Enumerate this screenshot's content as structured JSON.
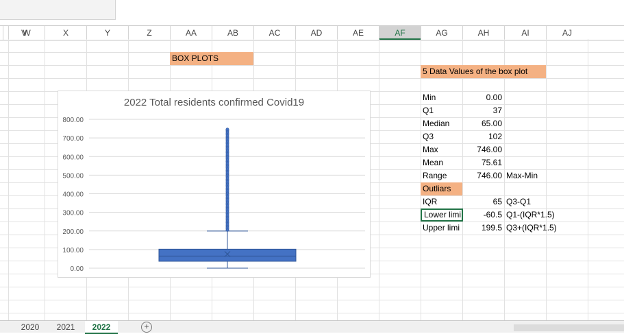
{
  "columns": [
    "V",
    "W",
    "X",
    "Y",
    "Z",
    "AA",
    "AB",
    "AC",
    "AD",
    "AE",
    "AF",
    "AG",
    "AH",
    "AI",
    "AJ"
  ],
  "active_column": "AF",
  "sheet": {
    "box_plots_label": "BOX PLOTS",
    "five_values_label": "5 Data Values of the box plot",
    "outliers_label": "Outliars",
    "stats": [
      {
        "label": "Min",
        "value": "0.00",
        "note": ""
      },
      {
        "label": "Q1",
        "value": "37",
        "note": ""
      },
      {
        "label": "Median",
        "value": "65.00",
        "note": ""
      },
      {
        "label": "Q3",
        "value": "102",
        "note": ""
      },
      {
        "label": "Max",
        "value": "746.00",
        "note": ""
      },
      {
        "label": "Mean",
        "value": "75.61",
        "note": ""
      },
      {
        "label": "Range",
        "value": "746.00",
        "note": "Max-Min"
      }
    ],
    "outlier_stats": [
      {
        "label": "IQR",
        "value": "65",
        "note": "Q3-Q1"
      },
      {
        "label": "Lower limi",
        "value": "-60.5",
        "note": "Q1-(IQR*1.5)"
      },
      {
        "label": "Upper limi",
        "value": "199.5",
        "note": "Q3+(IQR*1.5)"
      }
    ]
  },
  "chart_data": {
    "type": "box",
    "title": "2022 Total residents confirmed Covid19",
    "xlabel": "",
    "ylabel": "",
    "ylim": [
      0,
      800
    ],
    "yticks": [
      "800.00",
      "700.00",
      "600.00",
      "500.00",
      "400.00",
      "300.00",
      "200.00",
      "100.00",
      "0.00"
    ],
    "grid": true,
    "box": {
      "min": 0,
      "q1": 37,
      "median": 65,
      "q3": 102,
      "whisker_high": 199.5,
      "max": 746,
      "mean": 75.61
    },
    "outlier_range": [
      200,
      746
    ],
    "box_color": "#4472c4",
    "edge_color": "#2f5597"
  },
  "tabs": [
    {
      "label": "2020",
      "active": false
    },
    {
      "label": "2021",
      "active": false
    },
    {
      "label": "2022",
      "active": true
    }
  ],
  "add_sheet_icon": "plus-circle-icon"
}
